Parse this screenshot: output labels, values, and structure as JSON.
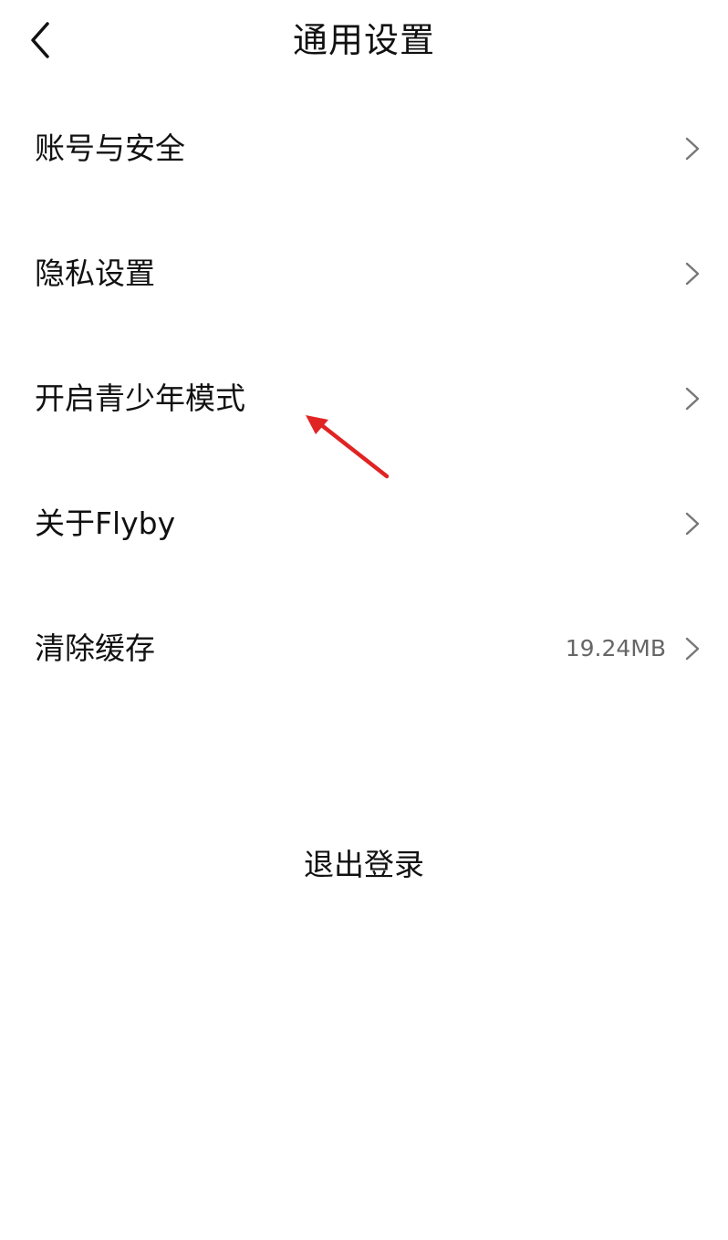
{
  "header": {
    "title": "通用设置",
    "back_icon": "chevron-left-icon"
  },
  "menu": {
    "items": [
      {
        "label": "账号与安全",
        "value": "",
        "icon": "chevron-right-icon"
      },
      {
        "label": "隐私设置",
        "value": "",
        "icon": "chevron-right-icon"
      },
      {
        "label": "开启青少年模式",
        "value": "",
        "icon": "chevron-right-icon"
      },
      {
        "label": "关于Flyby",
        "value": "",
        "icon": "chevron-right-icon"
      },
      {
        "label": "清除缓存",
        "value": "19.24MB",
        "icon": "chevron-right-icon"
      }
    ]
  },
  "logout": {
    "label": "退出登录"
  },
  "colors": {
    "text": "#111111",
    "secondary": "#666666",
    "chevron": "#777777",
    "annotation": "#e02424",
    "background": "#ffffff"
  }
}
